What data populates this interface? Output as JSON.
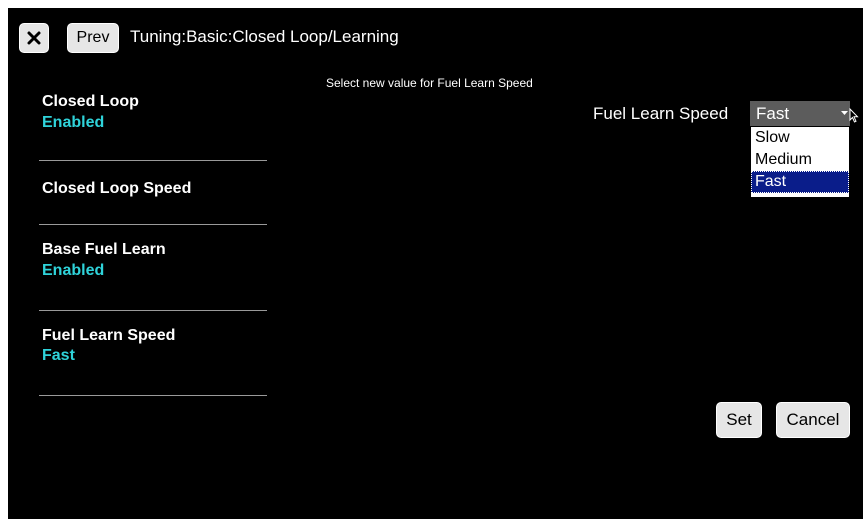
{
  "header": {
    "close_icon": "close-icon",
    "prev_label": "Prev",
    "breadcrumb": "Tuning:Basic:Closed Loop/Learning"
  },
  "sidebar": {
    "items": [
      {
        "label": "Closed Loop",
        "value": "Enabled"
      },
      {
        "label": "Closed Loop Speed",
        "value": ""
      },
      {
        "label": "Base Fuel Learn",
        "value": "Enabled"
      },
      {
        "label": "Fuel Learn Speed",
        "value": "Fast"
      }
    ]
  },
  "main": {
    "prompt": "Select new value for Fuel Learn Speed",
    "field_label": "Fuel Learn Speed",
    "select": {
      "value": "Fast",
      "options": [
        "Slow",
        "Medium",
        "Fast"
      ]
    },
    "set_label": "Set",
    "cancel_label": "Cancel"
  },
  "colors": {
    "background": "#000000",
    "accent_value": "#2fd3da",
    "selection": "#0a1d8a"
  }
}
